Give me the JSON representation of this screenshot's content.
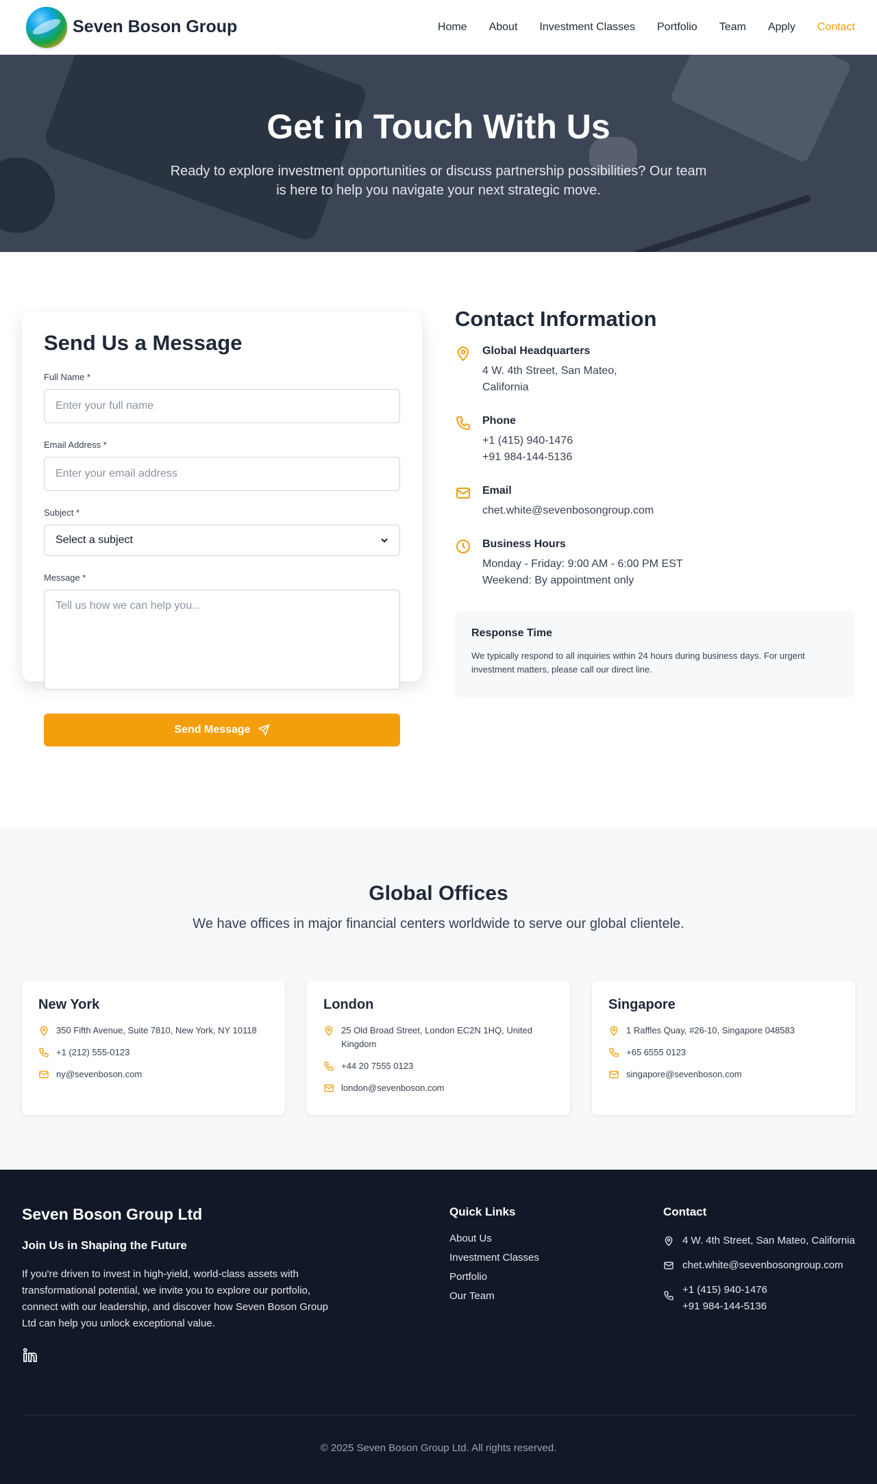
{
  "nav": {
    "brand": "Seven Boson Group",
    "items": [
      {
        "label": "Home",
        "active": false
      },
      {
        "label": "About",
        "active": false
      },
      {
        "label": "Investment Classes",
        "active": false
      },
      {
        "label": "Portfolio",
        "active": false
      },
      {
        "label": "Team",
        "active": false
      },
      {
        "label": "Apply",
        "active": false
      },
      {
        "label": "Contact",
        "active": true
      }
    ]
  },
  "hero": {
    "title": "Get in Touch With Us",
    "subtitle": "Ready to explore investment opportunities or discuss partnership possibilities? Our team is here to help you navigate your next strategic move."
  },
  "form": {
    "title": "Send Us a Message",
    "full_name_label": "Full Name *",
    "full_name_placeholder": "Enter your full name",
    "email_label": "Email Address *",
    "email_placeholder": "Enter your email address",
    "subject_label": "Subject *",
    "subject_value": "Select a subject",
    "message_label": "Message *",
    "message_placeholder": "Tell us how we can help you...",
    "submit_label": "Send Message"
  },
  "contact_info": {
    "title": "Contact Information",
    "hq_title": "Global Headquarters",
    "hq_line1": "4 W. 4th Street, San Mateo,",
    "hq_line2": "California",
    "phone_title": "Phone",
    "phone1": "+1 (415) 940-1476",
    "phone2": "+91 984-144-5136",
    "email_title": "Email",
    "email": "chet.white@sevenbosongroup.com",
    "hours_title": "Business Hours",
    "hours1": "Monday - Friday: 9:00 AM - 6:00 PM EST",
    "hours2": "Weekend: By appointment only",
    "response_title": "Response Time",
    "response_text": "We typically respond to all inquiries within 24 hours during business days. For urgent investment matters, please call our direct line."
  },
  "offices": {
    "title": "Global Offices",
    "subtitle": "We have offices in major financial centers worldwide to serve our global clientele.",
    "items": [
      {
        "city": "New York",
        "address": "350 Fifth Avenue, Suite 7810, New York, NY 10118",
        "phone": "+1 (212) 555-0123",
        "email": "ny@sevenboson.com"
      },
      {
        "city": "London",
        "address": "25 Old Broad Street, London EC2N 1HQ, United Kingdom",
        "phone": "+44 20 7555 0123",
        "email": "london@sevenboson.com"
      },
      {
        "city": "Singapore",
        "address": "1 Raffles Quay, #26-10, Singapore 048583",
        "phone": "+65 6555 0123",
        "email": "singapore@sevenboson.com"
      }
    ]
  },
  "footer": {
    "brand": "Seven Boson Group Ltd",
    "tagline": "Join Us in Shaping the Future",
    "text": "If you're driven to invest in high-yield, world-class assets with transformational potential, we invite you to explore our portfolio, connect with our leadership, and discover how Seven Boson Group Ltd can help you unlock exceptional value.",
    "quick_links_title": "Quick Links",
    "quick_links": [
      "About Us",
      "Investment Classes",
      "Portfolio",
      "Our Team"
    ],
    "contact_title": "Contact",
    "address": "4 W. 4th Street, San Mateo, California",
    "email": "chet.white@sevenbosongroup.com",
    "phone1": "+1 (415) 940-1476",
    "phone2": "+91 984-144-5136",
    "copyright": "© 2025 Seven Boson Group Ltd. All rights reserved."
  },
  "colors": {
    "accent": "#f59e0b",
    "dark": "#111827",
    "text": "#1f2937",
    "hero_bg": "#3b4556"
  }
}
